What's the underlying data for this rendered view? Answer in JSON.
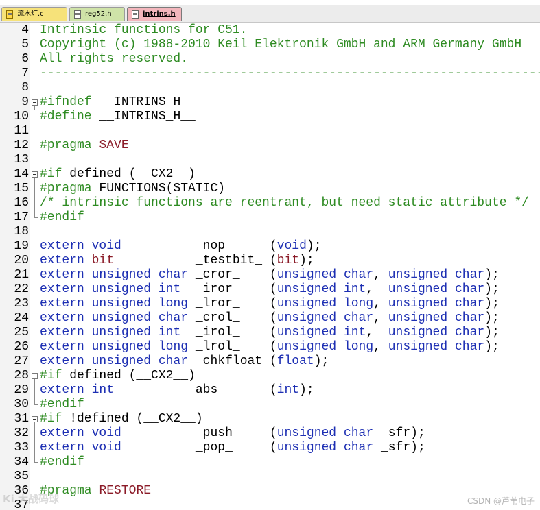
{
  "tabs": [
    {
      "label": "流水灯.c",
      "active": false,
      "color": "#f6e27a"
    },
    {
      "label": "reg52.h",
      "active": false,
      "color": "#cfe3a8"
    },
    {
      "label": "intrins.h",
      "active": true,
      "color": "#f3b6bc"
    }
  ],
  "editor": {
    "syntax_colors": {
      "comment": "#2e8b22",
      "keyword": "#1d2fb3",
      "type": "#8b1b28",
      "preprocessor": "#2e8b22"
    },
    "lines": [
      {
        "n": "4",
        "fold": "",
        "tokens": [
          {
            "t": "Intrinsic functions for C51.",
            "c": "cm"
          }
        ]
      },
      {
        "n": "5",
        "fold": "",
        "tokens": [
          {
            "t": "Copyright (c) 1988-2010 Keil Elektronik GmbH and ARM Germany GmbH",
            "c": "cm"
          }
        ]
      },
      {
        "n": "6",
        "fold": "",
        "tokens": [
          {
            "t": "All rights reserved.",
            "c": "cm"
          }
        ]
      },
      {
        "n": "7",
        "fold": "",
        "tokens": [
          {
            "t": "------------------------------------------------------------------------",
            "c": "cm"
          }
        ]
      },
      {
        "n": "8",
        "fold": "",
        "tokens": []
      },
      {
        "n": "9",
        "fold": "open",
        "tokens": [
          {
            "t": "#ifndef",
            "c": "pp"
          },
          {
            "t": " __INTRINS_H__",
            "c": "tx"
          }
        ]
      },
      {
        "n": "10",
        "fold": "",
        "tokens": [
          {
            "t": "#define",
            "c": "pp"
          },
          {
            "t": " __INTRINS_H__",
            "c": "tx"
          }
        ]
      },
      {
        "n": "11",
        "fold": "",
        "tokens": []
      },
      {
        "n": "12",
        "fold": "",
        "tokens": [
          {
            "t": "#pragma",
            "c": "pp"
          },
          {
            "t": " ",
            "c": "tx"
          },
          {
            "t": "SAVE",
            "c": "ty"
          }
        ]
      },
      {
        "n": "13",
        "fold": "",
        "tokens": []
      },
      {
        "n": "14",
        "fold": "open",
        "tokens": [
          {
            "t": "#if",
            "c": "pp"
          },
          {
            "t": " defined (__CX2__)",
            "c": "tx"
          }
        ]
      },
      {
        "n": "15",
        "fold": "bar",
        "tokens": [
          {
            "t": "#pragma",
            "c": "pp"
          },
          {
            "t": " FUNCTIONS(STATIC)",
            "c": "tx"
          }
        ]
      },
      {
        "n": "16",
        "fold": "bar",
        "tokens": [
          {
            "t": "/* intrinsic functions are reentrant, but need static attribute */",
            "c": "cm"
          }
        ]
      },
      {
        "n": "17",
        "fold": "end",
        "tokens": [
          {
            "t": "#endif",
            "c": "pp"
          }
        ]
      },
      {
        "n": "18",
        "fold": "",
        "tokens": []
      },
      {
        "n": "19",
        "fold": "",
        "tokens": [
          {
            "t": "extern",
            "c": "kw"
          },
          {
            "t": " ",
            "c": "tx"
          },
          {
            "t": "void",
            "c": "kw"
          },
          {
            "t": "          _nop_     (",
            "c": "tx"
          },
          {
            "t": "void",
            "c": "kw"
          },
          {
            "t": ");",
            "c": "tx"
          }
        ]
      },
      {
        "n": "20",
        "fold": "",
        "tokens": [
          {
            "t": "extern",
            "c": "kw"
          },
          {
            "t": " ",
            "c": "tx"
          },
          {
            "t": "bit",
            "c": "ty"
          },
          {
            "t": "           _testbit_ (",
            "c": "tx"
          },
          {
            "t": "bit",
            "c": "ty"
          },
          {
            "t": ");",
            "c": "tx"
          }
        ]
      },
      {
        "n": "21",
        "fold": "",
        "tokens": [
          {
            "t": "extern",
            "c": "kw"
          },
          {
            "t": " ",
            "c": "tx"
          },
          {
            "t": "unsigned",
            "c": "kw"
          },
          {
            "t": " ",
            "c": "tx"
          },
          {
            "t": "char",
            "c": "kw"
          },
          {
            "t": " _cror_    (",
            "c": "tx"
          },
          {
            "t": "unsigned",
            "c": "kw"
          },
          {
            "t": " ",
            "c": "tx"
          },
          {
            "t": "char",
            "c": "kw"
          },
          {
            "t": ", ",
            "c": "tx"
          },
          {
            "t": "unsigned",
            "c": "kw"
          },
          {
            "t": " ",
            "c": "tx"
          },
          {
            "t": "char",
            "c": "kw"
          },
          {
            "t": ");",
            "c": "tx"
          }
        ]
      },
      {
        "n": "22",
        "fold": "",
        "tokens": [
          {
            "t": "extern",
            "c": "kw"
          },
          {
            "t": " ",
            "c": "tx"
          },
          {
            "t": "unsigned",
            "c": "kw"
          },
          {
            "t": " ",
            "c": "tx"
          },
          {
            "t": "int",
            "c": "kw"
          },
          {
            "t": "  _iror_    (",
            "c": "tx"
          },
          {
            "t": "unsigned",
            "c": "kw"
          },
          {
            "t": " ",
            "c": "tx"
          },
          {
            "t": "int",
            "c": "kw"
          },
          {
            "t": ",  ",
            "c": "tx"
          },
          {
            "t": "unsigned",
            "c": "kw"
          },
          {
            "t": " ",
            "c": "tx"
          },
          {
            "t": "char",
            "c": "kw"
          },
          {
            "t": ");",
            "c": "tx"
          }
        ]
      },
      {
        "n": "23",
        "fold": "",
        "tokens": [
          {
            "t": "extern",
            "c": "kw"
          },
          {
            "t": " ",
            "c": "tx"
          },
          {
            "t": "unsigned",
            "c": "kw"
          },
          {
            "t": " ",
            "c": "tx"
          },
          {
            "t": "long",
            "c": "kw"
          },
          {
            "t": " _lror_    (",
            "c": "tx"
          },
          {
            "t": "unsigned",
            "c": "kw"
          },
          {
            "t": " ",
            "c": "tx"
          },
          {
            "t": "long",
            "c": "kw"
          },
          {
            "t": ", ",
            "c": "tx"
          },
          {
            "t": "unsigned",
            "c": "kw"
          },
          {
            "t": " ",
            "c": "tx"
          },
          {
            "t": "char",
            "c": "kw"
          },
          {
            "t": ");",
            "c": "tx"
          }
        ]
      },
      {
        "n": "24",
        "fold": "",
        "tokens": [
          {
            "t": "extern",
            "c": "kw"
          },
          {
            "t": " ",
            "c": "tx"
          },
          {
            "t": "unsigned",
            "c": "kw"
          },
          {
            "t": " ",
            "c": "tx"
          },
          {
            "t": "char",
            "c": "kw"
          },
          {
            "t": " _crol_    (",
            "c": "tx"
          },
          {
            "t": "unsigned",
            "c": "kw"
          },
          {
            "t": " ",
            "c": "tx"
          },
          {
            "t": "char",
            "c": "kw"
          },
          {
            "t": ", ",
            "c": "tx"
          },
          {
            "t": "unsigned",
            "c": "kw"
          },
          {
            "t": " ",
            "c": "tx"
          },
          {
            "t": "char",
            "c": "kw"
          },
          {
            "t": ");",
            "c": "tx"
          }
        ]
      },
      {
        "n": "25",
        "fold": "",
        "tokens": [
          {
            "t": "extern",
            "c": "kw"
          },
          {
            "t": " ",
            "c": "tx"
          },
          {
            "t": "unsigned",
            "c": "kw"
          },
          {
            "t": " ",
            "c": "tx"
          },
          {
            "t": "int",
            "c": "kw"
          },
          {
            "t": "  _irol_    (",
            "c": "tx"
          },
          {
            "t": "unsigned",
            "c": "kw"
          },
          {
            "t": " ",
            "c": "tx"
          },
          {
            "t": "int",
            "c": "kw"
          },
          {
            "t": ",  ",
            "c": "tx"
          },
          {
            "t": "unsigned",
            "c": "kw"
          },
          {
            "t": " ",
            "c": "tx"
          },
          {
            "t": "char",
            "c": "kw"
          },
          {
            "t": ");",
            "c": "tx"
          }
        ]
      },
      {
        "n": "26",
        "fold": "",
        "tokens": [
          {
            "t": "extern",
            "c": "kw"
          },
          {
            "t": " ",
            "c": "tx"
          },
          {
            "t": "unsigned",
            "c": "kw"
          },
          {
            "t": " ",
            "c": "tx"
          },
          {
            "t": "long",
            "c": "kw"
          },
          {
            "t": " _lrol_    (",
            "c": "tx"
          },
          {
            "t": "unsigned",
            "c": "kw"
          },
          {
            "t": " ",
            "c": "tx"
          },
          {
            "t": "long",
            "c": "kw"
          },
          {
            "t": ", ",
            "c": "tx"
          },
          {
            "t": "unsigned",
            "c": "kw"
          },
          {
            "t": " ",
            "c": "tx"
          },
          {
            "t": "char",
            "c": "kw"
          },
          {
            "t": ");",
            "c": "tx"
          }
        ]
      },
      {
        "n": "27",
        "fold": "",
        "tokens": [
          {
            "t": "extern",
            "c": "kw"
          },
          {
            "t": " ",
            "c": "tx"
          },
          {
            "t": "unsigned",
            "c": "kw"
          },
          {
            "t": " ",
            "c": "tx"
          },
          {
            "t": "char",
            "c": "kw"
          },
          {
            "t": " _chkfloat_(",
            "c": "tx"
          },
          {
            "t": "float",
            "c": "kw"
          },
          {
            "t": ");",
            "c": "tx"
          }
        ]
      },
      {
        "n": "28",
        "fold": "open",
        "tokens": [
          {
            "t": "#if",
            "c": "pp"
          },
          {
            "t": " defined (__CX2__)",
            "c": "tx"
          }
        ]
      },
      {
        "n": "29",
        "fold": "bar",
        "tokens": [
          {
            "t": "extern",
            "c": "kw"
          },
          {
            "t": " ",
            "c": "tx"
          },
          {
            "t": "int",
            "c": "kw"
          },
          {
            "t": "           abs       (",
            "c": "tx"
          },
          {
            "t": "int",
            "c": "kw"
          },
          {
            "t": ");",
            "c": "tx"
          }
        ]
      },
      {
        "n": "30",
        "fold": "end",
        "tokens": [
          {
            "t": "#endif",
            "c": "pp"
          }
        ]
      },
      {
        "n": "31",
        "fold": "open",
        "tokens": [
          {
            "t": "#if",
            "c": "pp"
          },
          {
            "t": " !defined (__CX2__)",
            "c": "tx"
          }
        ]
      },
      {
        "n": "32",
        "fold": "bar",
        "tokens": [
          {
            "t": "extern",
            "c": "kw"
          },
          {
            "t": " ",
            "c": "tx"
          },
          {
            "t": "void",
            "c": "kw"
          },
          {
            "t": "          _push_    (",
            "c": "tx"
          },
          {
            "t": "unsigned",
            "c": "kw"
          },
          {
            "t": " ",
            "c": "tx"
          },
          {
            "t": "char",
            "c": "kw"
          },
          {
            "t": " _sfr);",
            "c": "tx"
          }
        ]
      },
      {
        "n": "33",
        "fold": "bar",
        "tokens": [
          {
            "t": "extern",
            "c": "kw"
          },
          {
            "t": " ",
            "c": "tx"
          },
          {
            "t": "void",
            "c": "kw"
          },
          {
            "t": "          _pop_     (",
            "c": "tx"
          },
          {
            "t": "unsigned",
            "c": "kw"
          },
          {
            "t": " ",
            "c": "tx"
          },
          {
            "t": "char",
            "c": "kw"
          },
          {
            "t": " _sfr);",
            "c": "tx"
          }
        ]
      },
      {
        "n": "34",
        "fold": "end",
        "tokens": [
          {
            "t": "#endif",
            "c": "pp"
          }
        ]
      },
      {
        "n": "35",
        "fold": "",
        "tokens": []
      },
      {
        "n": "36",
        "fold": "",
        "tokens": [
          {
            "t": "#pragma",
            "c": "pp"
          },
          {
            "t": " ",
            "c": "tx"
          },
          {
            "t": "RESTORE",
            "c": "ty"
          }
        ]
      },
      {
        "n": "37",
        "fold": "",
        "tokens": []
      }
    ]
  },
  "watermark": {
    "left": "Ki 大战码球",
    "right": "CSDN @芦苇电子"
  }
}
